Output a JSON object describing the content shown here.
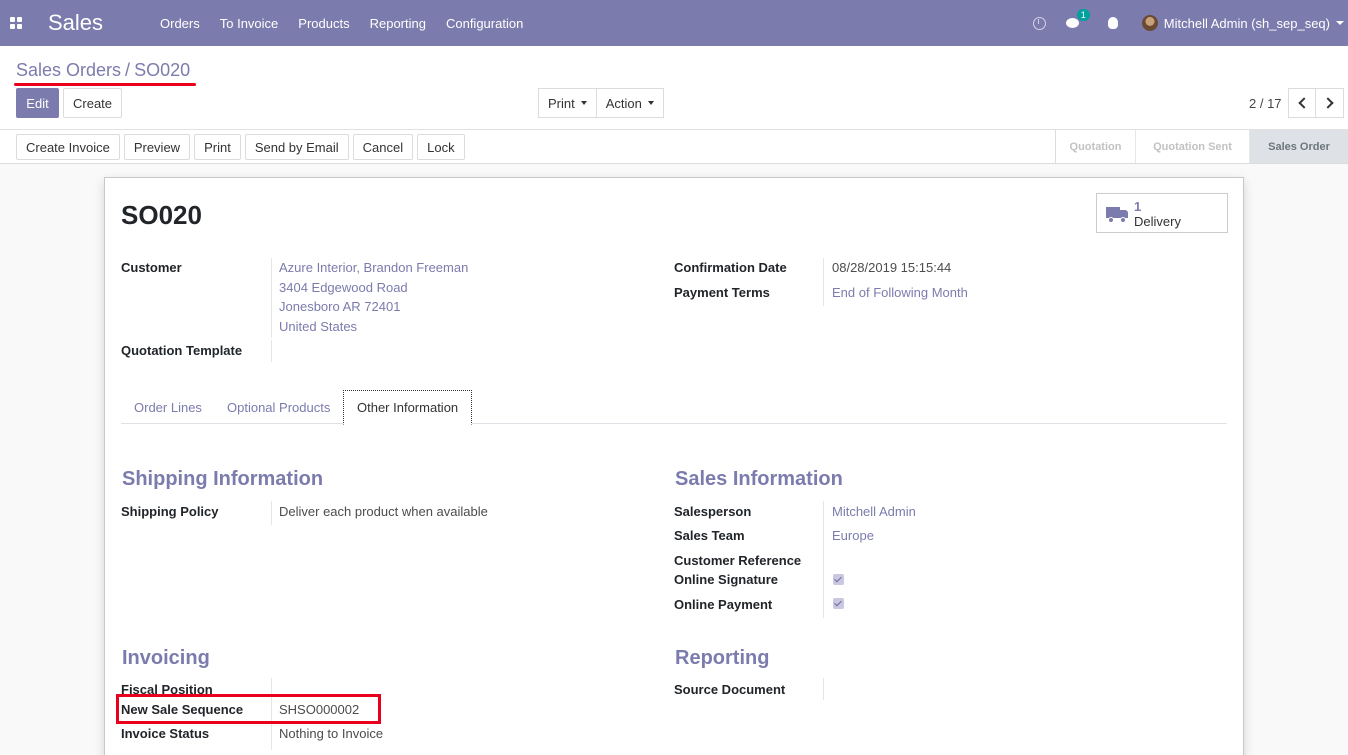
{
  "navbar": {
    "app_name": "Sales",
    "menu": [
      "Orders",
      "To Invoice",
      "Products",
      "Reporting",
      "Configuration"
    ],
    "chat_badge": "1",
    "user": "Mitchell Admin (sh_sep_seq)"
  },
  "control_panel": {
    "breadcrumb_parent": "Sales Orders",
    "breadcrumb_sep": "/",
    "breadcrumb_current": "SO020",
    "edit_label": "Edit",
    "create_label": "Create",
    "print_label": "Print",
    "action_label": "Action",
    "pager": "2 / 17"
  },
  "statusbar": {
    "buttons": [
      "Create Invoice",
      "Preview",
      "Print",
      "Send by Email",
      "Cancel",
      "Lock"
    ],
    "stages": [
      "Quotation",
      "Quotation Sent",
      "Sales Order"
    ],
    "active_stage": "Sales Order"
  },
  "sheet": {
    "title": "SO020",
    "delivery_count": "1",
    "delivery_label": "Delivery",
    "customer_label": "Customer",
    "customer_lines": [
      "Azure Interior, Brandon Freeman",
      "3404 Edgewood Road",
      "Jonesboro AR 72401",
      "United States"
    ],
    "quotation_template_label": "Quotation Template",
    "confirmation_date_label": "Confirmation Date",
    "confirmation_date": "08/28/2019 15:15:44",
    "payment_terms_label": "Payment Terms",
    "payment_terms": "End of Following Month",
    "tabs": [
      "Order Lines",
      "Optional Products",
      "Other Information"
    ],
    "active_tab": "Other Information",
    "shipping": {
      "title": "Shipping Information",
      "policy_label": "Shipping Policy",
      "policy_value": "Deliver each product when available"
    },
    "sales_info": {
      "title": "Sales Information",
      "salesperson_label": "Salesperson",
      "salesperson": "Mitchell Admin",
      "team_label": "Sales Team",
      "team": "Europe",
      "customer_ref_label": "Customer Reference",
      "online_signature_label": "Online Signature",
      "online_signature": true,
      "online_payment_label": "Online Payment",
      "online_payment": true
    },
    "invoicing": {
      "title": "Invoicing",
      "fiscal_position_label": "Fiscal Position",
      "new_sale_sequence_label": "New Sale Sequence",
      "new_sale_sequence": "SHSO000002",
      "invoice_status_label": "Invoice Status",
      "invoice_status": "Nothing to Invoice"
    },
    "reporting": {
      "title": "Reporting",
      "source_document_label": "Source Document"
    }
  },
  "colors": {
    "brand": "#7c7bad",
    "highlight": "#e8001c",
    "badge": "#00a09d"
  }
}
